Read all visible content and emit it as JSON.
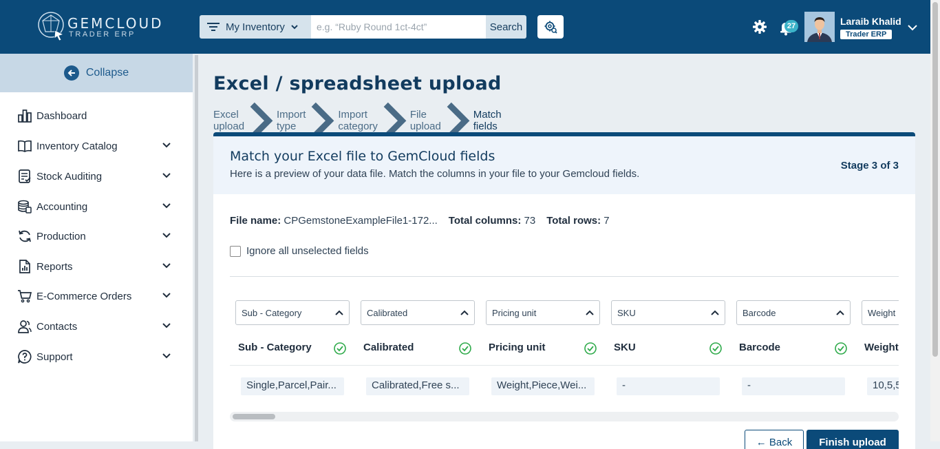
{
  "brand": {
    "name": "GEMCLOUD",
    "subtitle": "TRADER ERP"
  },
  "topbar": {
    "inventory_select": "My Inventory",
    "search_placeholder": "e.g. “Ruby Round 1ct-4ct”",
    "search_button": "Search",
    "notification_count": "27",
    "user_name": "Laraib Khalid",
    "user_role": "Trader ERP"
  },
  "sidebar": {
    "collapse_label": "Collapse",
    "items": [
      {
        "label": "Dashboard",
        "icon": "dashboard-icon",
        "has_children": false
      },
      {
        "label": "Inventory Catalog",
        "icon": "book-icon",
        "has_children": true
      },
      {
        "label": "Stock Auditing",
        "icon": "clipboard-icon",
        "has_children": true
      },
      {
        "label": "Accounting",
        "icon": "coins-icon",
        "has_children": true
      },
      {
        "label": "Production",
        "icon": "refresh-icon",
        "has_children": true
      },
      {
        "label": "Reports",
        "icon": "report-icon",
        "has_children": true
      },
      {
        "label": "E-Commerce Orders",
        "icon": "cart-icon",
        "has_children": true
      },
      {
        "label": "Contacts",
        "icon": "contacts-icon",
        "has_children": true
      },
      {
        "label": "Support",
        "icon": "help-icon",
        "has_children": true
      }
    ]
  },
  "page": {
    "title": "Excel / spreadsheet upload",
    "breadcrumbs": [
      "Excel upload",
      "Import type",
      "Import category",
      "File upload",
      "Match fields"
    ]
  },
  "card": {
    "title": "Match your Excel file to GemCloud fields",
    "description": "Here is a preview of your data file. Match the columns in your file to your Gemcloud fields.",
    "stage": "Stage 3 of 3",
    "file_name_label": "File name:",
    "file_name": "CPGemstoneExampleFile1-172...",
    "total_columns_label": "Total columns:",
    "total_columns": "73",
    "total_rows_label": "Total rows:",
    "total_rows": "7",
    "ignore_label": "Ignore all unselected fields",
    "columns": [
      {
        "field": "Sub - Category",
        "header": "Sub - Category",
        "value": "Single,Parcel,Pair..."
      },
      {
        "field": "Calibrated",
        "header": "Calibrated",
        "value": "Calibrated,Free s..."
      },
      {
        "field": "Pricing unit",
        "header": "Pricing unit",
        "value": "Weight,Piece,Wei..."
      },
      {
        "field": "SKU",
        "header": "SKU",
        "value": "-"
      },
      {
        "field": "Barcode",
        "header": "Barcode",
        "value": "-"
      },
      {
        "field": "Weight",
        "header": "Weight",
        "value": "10,5,5"
      }
    ],
    "back_button": "Back",
    "finish_button": "Finish upload"
  },
  "colors": {
    "primary": "#0b4a79",
    "accent": "#3bb3c9",
    "check": "#2eaa4a"
  }
}
